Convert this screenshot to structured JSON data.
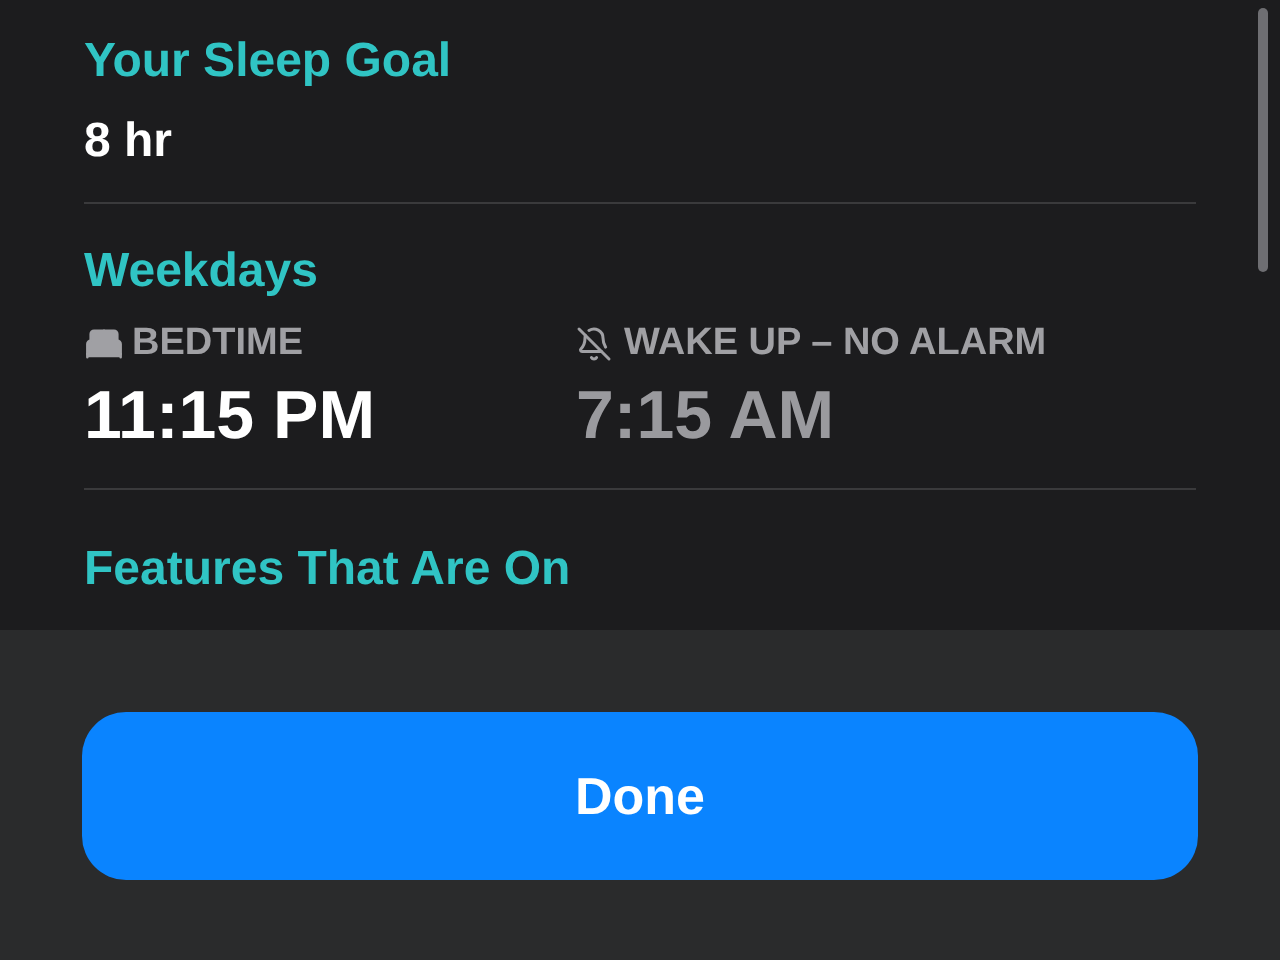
{
  "sleep_goal": {
    "heading": "Your Sleep Goal",
    "value": "8 hr"
  },
  "schedule": {
    "heading": "Weekdays",
    "items": [
      {
        "kind": "bedtime",
        "label": "BEDTIME",
        "time": "11:15 PM",
        "dimmed": false
      },
      {
        "kind": "wake",
        "label": "WAKE UP – NO ALARM",
        "time": "7:15 AM",
        "dimmed": true
      }
    ]
  },
  "features": {
    "heading": "Features That Are On"
  },
  "done_button": "Done"
}
